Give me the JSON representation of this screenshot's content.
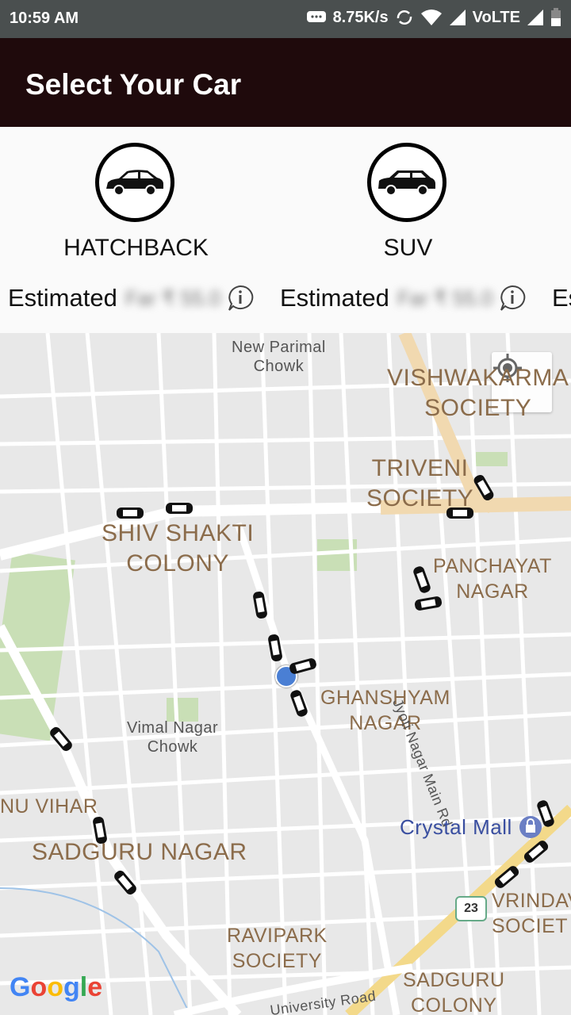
{
  "status_bar": {
    "time": "10:59 AM",
    "speed": "8.75K/s",
    "network": "VoLTE"
  },
  "app_bar": {
    "title": "Select Your Car"
  },
  "cars": [
    {
      "name": "HATCHBACK",
      "estimate_label": "Estimated",
      "estimate_value": "Far ₹ 55.0",
      "icon": "hatchback-car-icon"
    },
    {
      "name": "SUV",
      "estimate_label": "Estimated",
      "estimate_value": "Far ₹ 55.0",
      "icon": "suv-car-icon"
    }
  ],
  "partial_third_label": "Es",
  "map": {
    "labels": {
      "new_parimal": "New Parimal\nChowk",
      "vishwakarma": "VISHWAKARMA\nSOCIETY",
      "triveni": "TRIVENI\nSOCIETY",
      "shiv_shakti": "SHIV SHAKTI\nCOLONY",
      "panchayat": "PANCHAYAT\nNAGAR",
      "ghanshyam": "GHANSHYAM\nNAGAR",
      "jyoti_road": "Jyoti Nagar Main Rd",
      "vimal": "Vimal Nagar\nChowk",
      "nu_vihar": "NU VIHAR",
      "sadguru": "SADGURU NAGAR",
      "crystal": "Crystal Mall",
      "vrindav": "VRINDAV\nSOCIET",
      "ravipark": "RAVIPARK\nSOCIETY",
      "university": "University Road",
      "sadguru_colony": "SADGURU\nCOLONY",
      "highway": "23"
    },
    "google_logo": "Google"
  },
  "colors": {
    "appbar": "#1f0a0c",
    "statusbar": "#4a4f4f",
    "map_bg": "#e6e6e6"
  }
}
